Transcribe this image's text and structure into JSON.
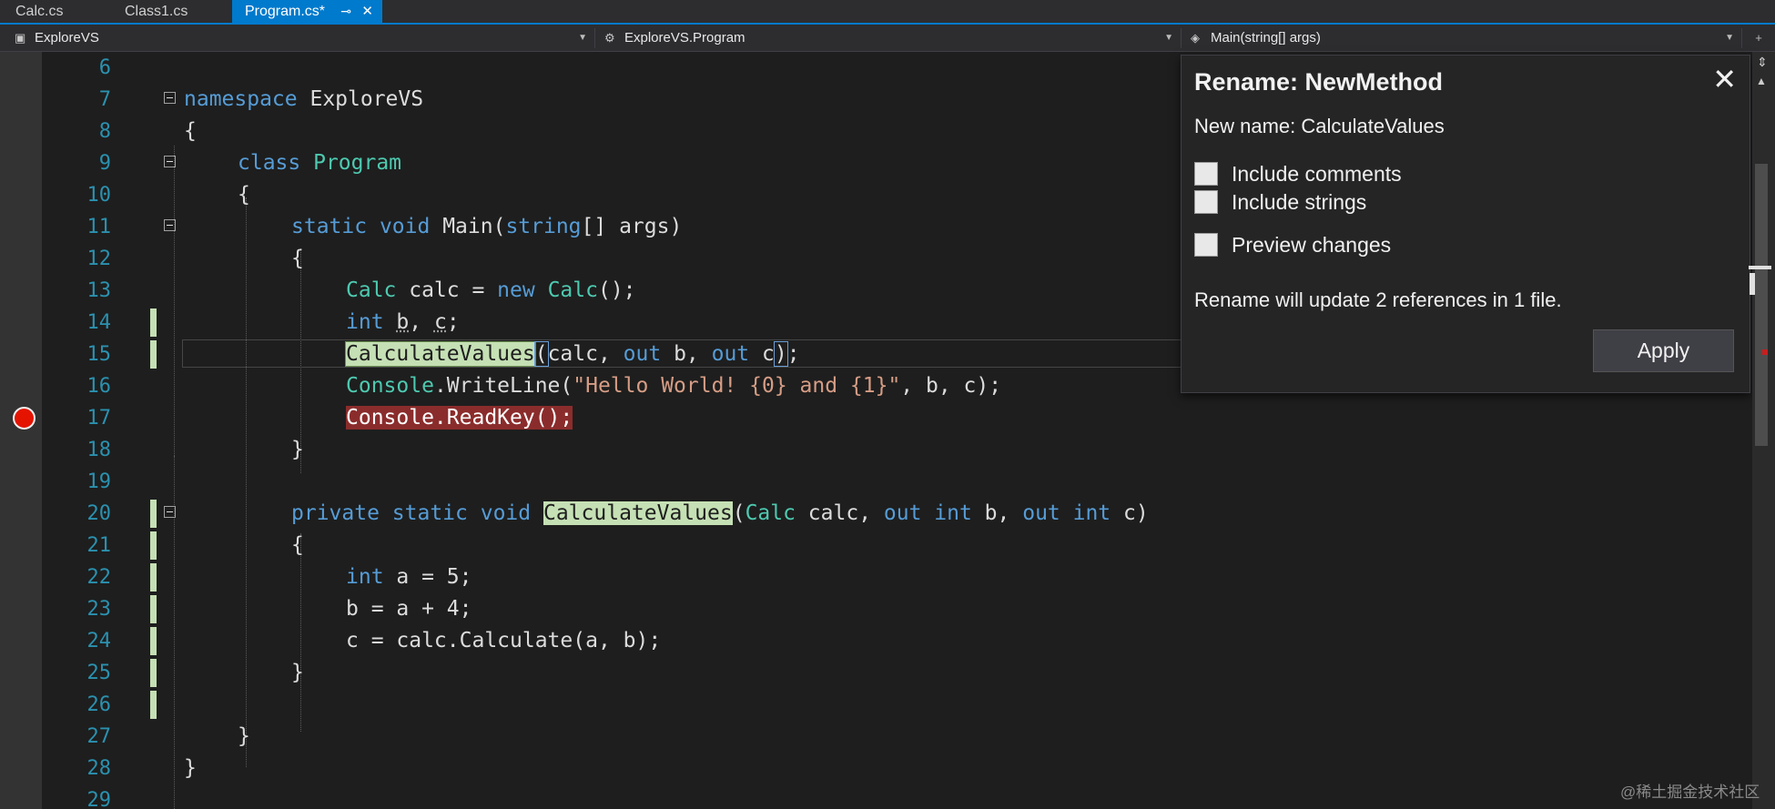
{
  "tabs": [
    {
      "label": "Calc.cs",
      "active": false
    },
    {
      "label": "Class1.cs",
      "active": false
    },
    {
      "label": "Program.cs*",
      "active": true,
      "pin_icon": "⊸",
      "close_icon": "✕"
    }
  ],
  "navbar": {
    "project": "ExploreVS",
    "type": "ExploreVS.Program",
    "member": "Main(string[] args)"
  },
  "line_numbers": [
    "6",
    "7",
    "8",
    "9",
    "10",
    "11",
    "12",
    "13",
    "14",
    "15",
    "16",
    "17",
    "18",
    "19",
    "20",
    "21",
    "22",
    "23",
    "24",
    "25",
    "26",
    "27",
    "28",
    "29"
  ],
  "code": {
    "l7_kw": "namespace",
    "l7_name": " ExploreVS",
    "l8": "{",
    "l9_kw": "class",
    "l9_name": " Program",
    "l10": "{",
    "l11_kw1": "static",
    "l11_kw2": " void",
    "l11_name": " Main(",
    "l11_kw3": "string",
    "l11_rest": "[] args)",
    "l12": "{",
    "l13_ty1": "Calc",
    "l13_mid": " calc = ",
    "l13_kw": "new",
    "l13_ty2": " Calc",
    "l13_end": "();",
    "l14_kw": "int",
    "l14_sp": " ",
    "l14_b": "b",
    "l14_comma": ", ",
    "l14_c": "c",
    "l14_end": ";",
    "l15_method": "CalculateValues",
    "l15_paren": "(",
    "l15_a": "calc, ",
    "l15_out1": "out",
    "l15_b": " b, ",
    "l15_out2": "out",
    "l15_c": " c",
    "l15_close": ")",
    "l15_end": ";",
    "l16_ty": "Console",
    "l16_call": ".WriteLine(",
    "l16_str": "\"Hello World! {0} and {1}\"",
    "l16_end": ", b, c);",
    "l17": "Console.ReadKey();",
    "l18": "}",
    "l20_kw1": "private",
    "l20_kw2": " static",
    "l20_kw3": " void",
    "l20_sp": " ",
    "l20_method": "CalculateValues",
    "l20_open": "(",
    "l20_ty": "Calc",
    "l20_p1": " calc, ",
    "l20_out1": "out",
    "l20_int1": " int",
    "l20_p2": " b, ",
    "l20_out2": "out",
    "l20_int2": " int",
    "l20_p3": " c)",
    "l21": "{",
    "l22_kw": "int",
    "l22_rest": " a = 5;",
    "l23": "b = a + 4;",
    "l24": "c = calc.Calculate(a, b);",
    "l25": "}",
    "l27": "}",
    "l28": "}"
  },
  "rename_dialog": {
    "title": "Rename: NewMethod",
    "close_icon": "✕",
    "new_name": "New name: CalculateValues",
    "options": [
      {
        "label": "Include comments",
        "checked": false
      },
      {
        "label": "Include strings",
        "checked": false
      },
      {
        "label": "Preview changes",
        "checked": false
      }
    ],
    "info": "Rename will update 2 references in 1 file.",
    "apply_label": "Apply"
  },
  "watermark": "@稀土掘金技术社区",
  "colors": {
    "accent": "#007acc",
    "keyword": "#569cd6",
    "type": "#4ec9b0",
    "string": "#d69d85",
    "rename_highlight": "#c5e0b4",
    "breakpoint": "#e51400"
  }
}
